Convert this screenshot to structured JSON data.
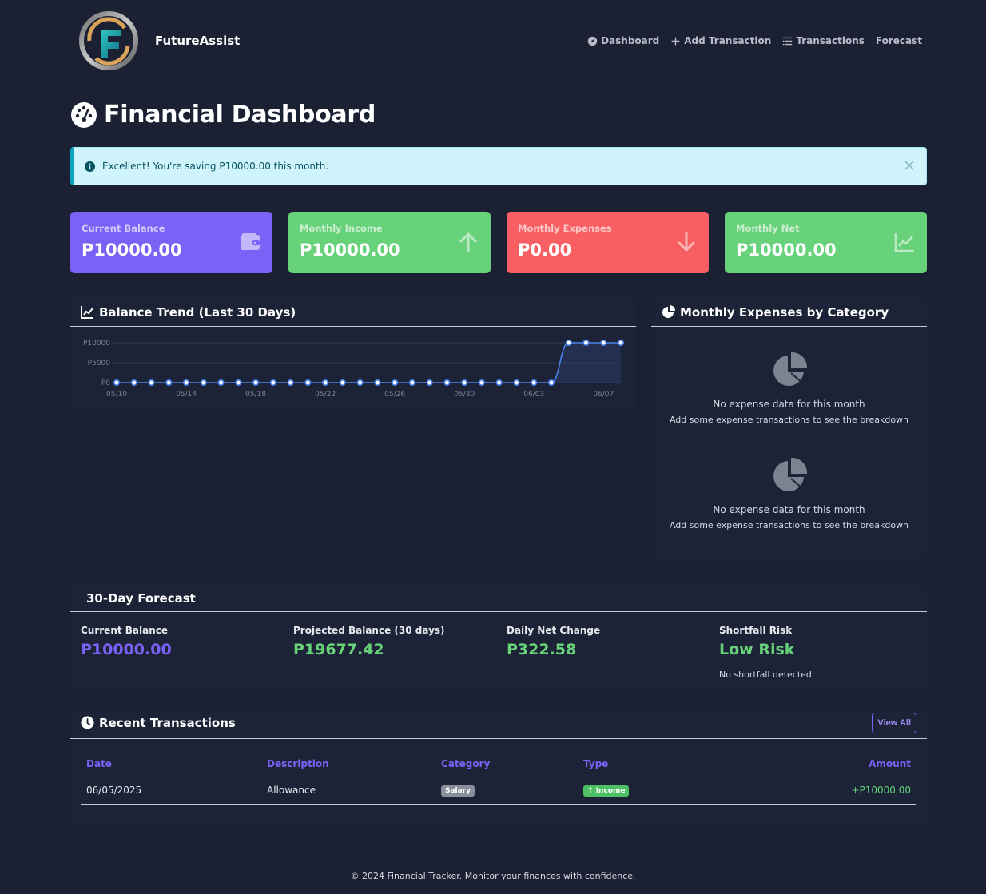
{
  "brand": {
    "name": "FutureAssist"
  },
  "nav": {
    "links": [
      {
        "label": "Dashboard",
        "icon": "dashboard-icon"
      },
      {
        "label": "Add Transaction",
        "icon": "plus-icon"
      },
      {
        "label": "Transactions",
        "icon": "list-icon"
      },
      {
        "label": "Forecast",
        "icon": ""
      }
    ]
  },
  "page": {
    "title": "Financial Dashboard"
  },
  "alert": {
    "message": "Excellent! You're saving P10000.00 this month."
  },
  "stats": [
    {
      "label": "Current Balance",
      "value": "P10000.00",
      "icon": "wallet-icon",
      "color": "#7b61f5"
    },
    {
      "label": "Monthly Income",
      "value": "P10000.00",
      "icon": "arrow-up-icon",
      "color": "#68d27a"
    },
    {
      "label": "Monthly Expenses",
      "value": "P0.00",
      "icon": "arrow-down-icon",
      "color": "#f85f62"
    },
    {
      "label": "Monthly Net",
      "value": "P10000.00",
      "icon": "chart-line-icon",
      "color": "#68d27a"
    }
  ],
  "trend": {
    "title": "Balance Trend (Last 30 Days)",
    "chart_data": {
      "type": "area",
      "title": "Balance Trend (Last 30 Days)",
      "xlabel": "",
      "ylabel": "",
      "ylim": [
        0,
        10000
      ],
      "yticks": [
        "P10000",
        "P5000",
        "P0"
      ],
      "xticks": [
        "05/10",
        "05/14",
        "05/18",
        "05/22",
        "05/26",
        "05/30",
        "06/03",
        "06/07"
      ],
      "x": [
        "05/10",
        "05/11",
        "05/12",
        "05/13",
        "05/14",
        "05/15",
        "05/16",
        "05/17",
        "05/18",
        "05/19",
        "05/20",
        "05/21",
        "05/22",
        "05/23",
        "05/24",
        "05/25",
        "05/26",
        "05/27",
        "05/28",
        "05/29",
        "05/30",
        "05/31",
        "06/01",
        "06/02",
        "06/03",
        "06/04",
        "06/05",
        "06/06",
        "06/07",
        "06/08"
      ],
      "values": [
        0,
        0,
        0,
        0,
        0,
        0,
        0,
        0,
        0,
        0,
        0,
        0,
        0,
        0,
        0,
        0,
        0,
        0,
        0,
        0,
        0,
        0,
        0,
        0,
        0,
        0,
        10000,
        10000,
        10000,
        10000
      ],
      "grid": true,
      "color": "#4a82ee"
    }
  },
  "categories": {
    "title": "Monthly Expenses by Category",
    "empty_title": "No expense data for this month",
    "empty_sub": "Add some expense transactions to see the breakdown"
  },
  "forecast": {
    "title": "30-Day Forecast",
    "items": [
      {
        "label": "Current Balance",
        "value": "P10000.00",
        "color": "#7b61f5",
        "sub": ""
      },
      {
        "label": "Projected Balance (30 days)",
        "value": "P19677.42",
        "color": "#68d27a",
        "sub": ""
      },
      {
        "label": "Daily Net Change",
        "value": "P322.58",
        "color": "#68d27a",
        "sub": ""
      },
      {
        "label": "Shortfall Risk",
        "value": "Low Risk",
        "color": "#68d27a",
        "sub": "No shortfall detected"
      }
    ]
  },
  "recent": {
    "title": "Recent Transactions",
    "view_all": "View All",
    "columns": [
      "Date",
      "Description",
      "Category",
      "Type",
      "Amount"
    ],
    "rows": [
      {
        "date": "06/05/2025",
        "description": "Allowance",
        "category": "Salary",
        "type": "Income",
        "amount": "+P10000.00"
      }
    ]
  },
  "footer": {
    "text": "© 2024 Financial Tracker. Monitor your finances with confidence."
  }
}
